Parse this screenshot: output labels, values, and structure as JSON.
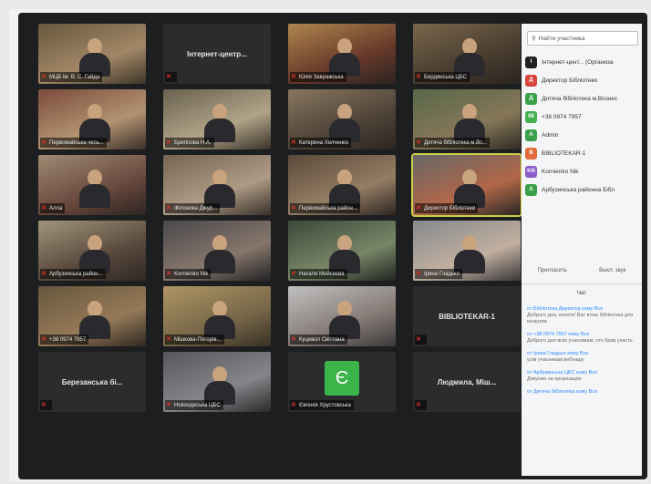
{
  "gallery": {
    "tiles": [
      {
        "name": "МЦБ ім. В. С. Гайда",
        "center": "",
        "color": "photo1"
      },
      {
        "name": "",
        "center": "Інтернет-центр...",
        "color": "dark"
      },
      {
        "name": "Юлія Завражська",
        "center": "",
        "color": "photo2"
      },
      {
        "name": "Бердянська ЦБС",
        "center": "",
        "color": "photo3"
      },
      {
        "name": "Первомайська чесь...",
        "center": "",
        "color": "photo4"
      },
      {
        "name": "Бригіпова Н.А.",
        "center": "",
        "color": "photo5"
      },
      {
        "name": "Катерина Хелченко",
        "center": "",
        "color": "photo6"
      },
      {
        "name": "Дитяча бібліотека м.Вс...",
        "center": "",
        "color": "photo7"
      },
      {
        "name": "Алла",
        "center": "",
        "color": "photo8"
      },
      {
        "name": "Філонова Джур...",
        "center": "",
        "color": "photo9"
      },
      {
        "name": "Первомайська район...",
        "center": "",
        "color": "photo10"
      },
      {
        "name": "Директор Бібліотеки",
        "center": "",
        "color": "photo11"
      },
      {
        "name": "Арбузинська район...",
        "center": "",
        "color": "photo12"
      },
      {
        "name": "Kornienko Nik",
        "center": "",
        "color": "photo13"
      },
      {
        "name": "Наталя Мойсеєва",
        "center": "",
        "color": "photo14"
      },
      {
        "name": "Ірина Гладько",
        "center": "",
        "color": "photo15"
      },
      {
        "name": "+38 0974 7957",
        "center": "",
        "color": "photo16"
      },
      {
        "name": "Мішкова-Погорів...",
        "center": "",
        "color": "photo17"
      },
      {
        "name": "Куцевол Світлана",
        "center": "",
        "color": "photo18"
      },
      {
        "name": "",
        "center": "BIBLIOTEKAR-1",
        "color": "dark"
      },
      {
        "name": "",
        "center": "Березанська бі...",
        "color": "dark"
      },
      {
        "name": "Новоодеська ЦБС",
        "center": "",
        "color": "photo19"
      },
      {
        "name": "Євгенія Хрустовська",
        "center": "",
        "color": "avatar"
      },
      {
        "name": "",
        "center": "Людмила, Міш...",
        "color": "dark"
      }
    ]
  },
  "panel": {
    "search_placeholder": "Найти участника",
    "participants": [
      {
        "initial": "І",
        "name": "Інтернет-цент... (Организа",
        "color": "#222222"
      },
      {
        "initial": "Д",
        "name": "Директор Бібліотеки",
        "color": "#d9453a"
      },
      {
        "initial": "Д",
        "name": "Дитяча бібліотека м.Вознес",
        "color": "#3aa14a"
      },
      {
        "initial": "98",
        "name": "+38 0974 7957",
        "color": "#43b04d"
      },
      {
        "initial": "А",
        "name": "Admin",
        "color": "#3aa14a"
      },
      {
        "initial": "В",
        "name": "BIBLIOTEKAR-1",
        "color": "#e36a3a"
      },
      {
        "initial": "KN",
        "name": "Kornienko Nik",
        "color": "#8a5cc6"
      },
      {
        "initial": "А",
        "name": "Арбузинська районна Бібл",
        "color": "#3aa14a"
      }
    ],
    "invite_label": "Пригласить",
    "mute_label": "Выкл. звук",
    "chat_title": "Чат",
    "chat": [
      {
        "from": "от Бібліотека Директор кому Все",
        "text": "Доброго дня, колеги! Вас вітає бібліотека для юнацтва"
      },
      {
        "from": "от +38 0974 7957 кому Все",
        "text": "Доброго дня всім учасникам, хто брав участь"
      },
      {
        "from": "от Ірина Гладько кому Все",
        "text": "усім учасникам вебінару"
      },
      {
        "from": "от Арбузинська ЦБС кому Все",
        "text": "Дякуємо за організацію"
      },
      {
        "from": "от Дитяча бібліотека кому Все",
        "text": ""
      }
    ]
  }
}
